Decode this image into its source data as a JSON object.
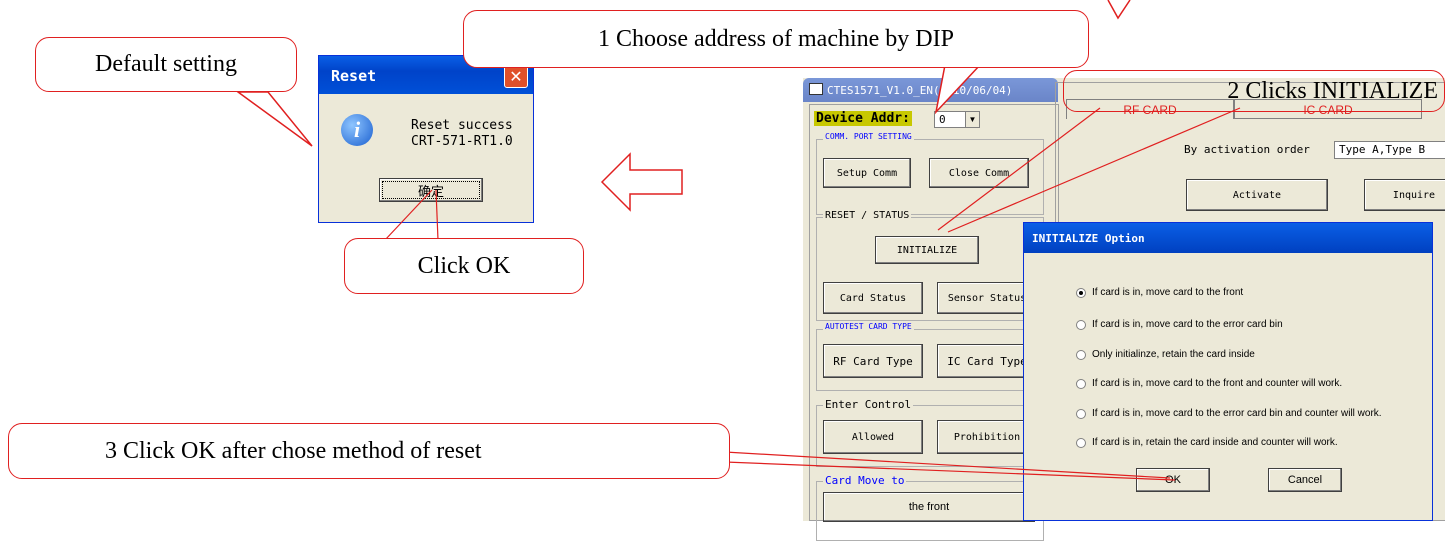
{
  "annotations": {
    "default_setting": "Default setting",
    "step1": "1 Choose address of machine by DIP",
    "step2": "2 Clicks INITIALIZE",
    "step3": "3 Click OK after chose method of reset",
    "click_ok": "Click OK"
  },
  "reset_dialog": {
    "title": "Reset",
    "message_line1": "Reset success",
    "message_line2": "CRT-571-RT1.0",
    "ok_label": "确定"
  },
  "app": {
    "title": "CTES1571_V1.0_EN(2010/06/04)",
    "device_addr_label": "Device Addr:",
    "device_addr_value": "0",
    "comm_group": "COMM. PORT SETTING",
    "setup_comm": "Setup Comm",
    "close_comm": "Close Comm",
    "reset_group": "RESET / STATUS",
    "initialize": "INITIALIZE",
    "card_status": "Card Status",
    "sensor_status": "Sensor Status",
    "autotest_group": "AUTOTEST CARD TYPE",
    "rf_card_type": "RF Card Type",
    "ic_card_type": "IC Card Type",
    "enter_group": "Enter Control",
    "allowed": "Allowed",
    "prohibition": "Prohibition",
    "card_move_group": "Card Move to",
    "the_front": "the front",
    "tabs": [
      "RF CARD",
      "IC CARD"
    ],
    "activation_label": "By activation order",
    "activation_value": "Type A,Type B",
    "activate": "Activate",
    "inquire": "Inquire"
  },
  "init_dialog": {
    "title": "INITIALIZE Option",
    "options": [
      "If card is in, move card to the front",
      "If card is in, move card to the error card bin",
      "Only initialinze, retain the card inside",
      "If card is in, move card to the front and counter will work.",
      "If card is in, move card to the error card bin and counter will work.",
      "If card is in, retain the card inside  and counter will work."
    ],
    "selected_index": 0,
    "ok": "OK",
    "cancel": "Cancel"
  },
  "colors": {
    "callout_border": "#e02020",
    "titlebar_blue": "#0a5fe6",
    "dialog_bg": "#ece9d8"
  }
}
